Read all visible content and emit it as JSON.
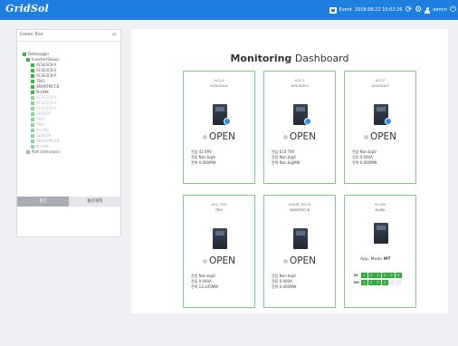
{
  "app": {
    "logo": "GridSol",
    "event_label": "Event",
    "datetime": "2018.08.22 10:02:26",
    "user": "admin"
  },
  "colors": {
    "accent": "#1e7fe0",
    "ok": "#2fae3b",
    "card_border": "#7bd07f"
  },
  "icons": [
    "event-icon",
    "refresh-icon",
    "gear-icon",
    "user-icon",
    "logout-icon",
    "shield-icon",
    "chevron-left-icon"
  ],
  "sidebar": {
    "title": "Comm Tree",
    "collapse_glyph": "<",
    "tree": [
      {
        "label": "DataLogger",
        "level": 0,
        "state": "on"
      },
      {
        "label": "Inverter(Slave)",
        "level": 1,
        "state": "on"
      },
      {
        "label": "ACS03CK-A",
        "level": 2,
        "state": "on"
      },
      {
        "label": "ACS03CK-S",
        "level": 2,
        "state": "on"
      },
      {
        "label": "ACS03CK-P",
        "level": 2,
        "state": "on"
      },
      {
        "label": "TRIO",
        "level": 2,
        "state": "on"
      },
      {
        "label": "SMARTMCCB",
        "level": 2,
        "state": "on"
      },
      {
        "label": "M-LINK",
        "level": 2,
        "state": "on"
      },
      {
        "label": "ACS03CK-A",
        "level": 2,
        "state": "dim"
      },
      {
        "label": "ACS03CK-A",
        "level": 2,
        "state": "dim"
      },
      {
        "label": "ACS03CK-A",
        "level": 2,
        "state": "dim"
      },
      {
        "label": "SENSOR",
        "level": 2,
        "state": "dim"
      },
      {
        "label": "TRIO",
        "level": 2,
        "state": "dim"
      },
      {
        "label": "TRIO",
        "level": 2,
        "state": "dim"
      },
      {
        "label": "M-LINK",
        "level": 2,
        "state": "dim"
      },
      {
        "label": "SENSOR",
        "level": 2,
        "state": "dim"
      },
      {
        "label": "SMARTMCCB",
        "level": 2,
        "state": "dim"
      },
      {
        "label": "M-LINK",
        "level": 2,
        "state": "dim"
      },
      {
        "label": "Port (Unknown)",
        "level": 1,
        "state": "grey"
      }
    ],
    "buttons": {
      "left": "편집",
      "right": "통신해제"
    }
  },
  "dashboard": {
    "title_bold": "Monitoring",
    "title_rest": "Dashboard",
    "cards": [
      {
        "name": "ACS_A",
        "model": "ACS03CK-A",
        "status": "OPEN",
        "meas": [
          "전압 42.09V",
          "전류 Nan.bigA",
          "전력 0.000MW"
        ]
      },
      {
        "name": "ACS_S",
        "model": "ACS03CK-S",
        "status": "OPEN",
        "meas": [
          "전압 610.78V",
          "전류 Nan.bigA",
          "전력 Nan.bigMW"
        ]
      },
      {
        "name": "ACS_P",
        "model": "ACS03CK-P",
        "status": "OPEN",
        "meas": [
          "전압 Nan.bigV",
          "전류 0.000A",
          "전력 0.000MW"
        ]
      },
      {
        "name": "ACS_TRIO",
        "model": "TRIO",
        "status": "OPEN",
        "meas": [
          "전압 Nan.bigV",
          "전류 0.000A",
          "전력 13.145MW"
        ]
      },
      {
        "name": "SMART_MCCB",
        "model": "SMARTMCCB",
        "status": "OPEN",
        "meas": [
          "전압 Nan.bigV",
          "전류 0.000A",
          "전력 0.000MW"
        ]
      },
      {
        "name": "M-LINK",
        "model": "MLINK",
        "status": "",
        "mode_label": "App. Mode",
        "mode_value": "MT",
        "di": [
          "1",
          "2",
          "3",
          "4",
          "5",
          "6"
        ],
        "do": [
          "1",
          "2",
          "3",
          "4",
          "-",
          "-"
        ]
      }
    ]
  }
}
